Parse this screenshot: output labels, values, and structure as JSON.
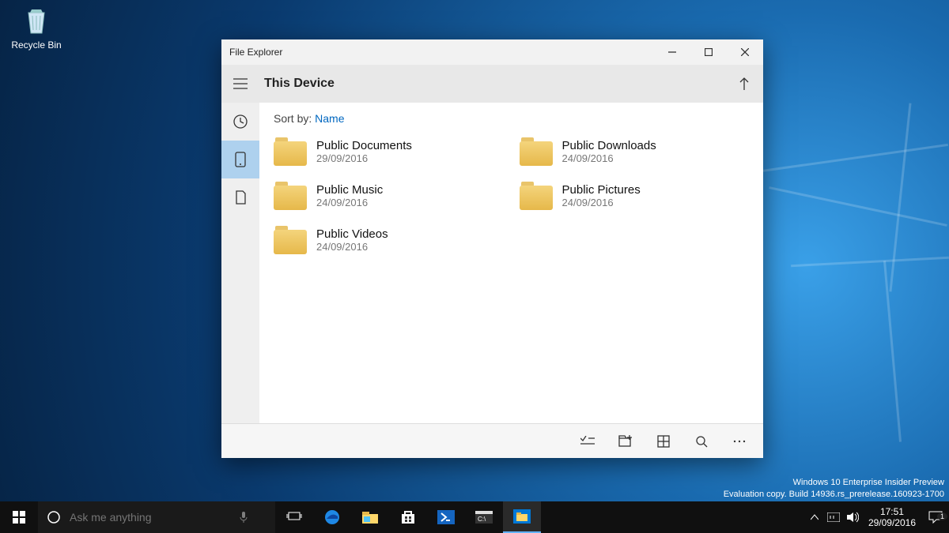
{
  "desktop": {
    "recycle_bin_label": "Recycle Bin",
    "watermark_line1": "Windows 10 Enterprise Insider Preview",
    "watermark_line2": "Evaluation copy. Build 14936.rs_prerelease.160923-1700"
  },
  "window": {
    "title": "File Explorer",
    "location": "This Device",
    "sort_label": "Sort by:",
    "sort_value": "Name",
    "folders": [
      {
        "name": "Public Documents",
        "date": "29/09/2016"
      },
      {
        "name": "Public Downloads",
        "date": "24/09/2016"
      },
      {
        "name": "Public Music",
        "date": "24/09/2016"
      },
      {
        "name": "Public Pictures",
        "date": "24/09/2016"
      },
      {
        "name": "Public Videos",
        "date": "24/09/2016"
      }
    ]
  },
  "taskbar": {
    "search_placeholder": "Ask me anything",
    "time": "17:51",
    "date": "29/09/2016",
    "notification_count": "1"
  }
}
